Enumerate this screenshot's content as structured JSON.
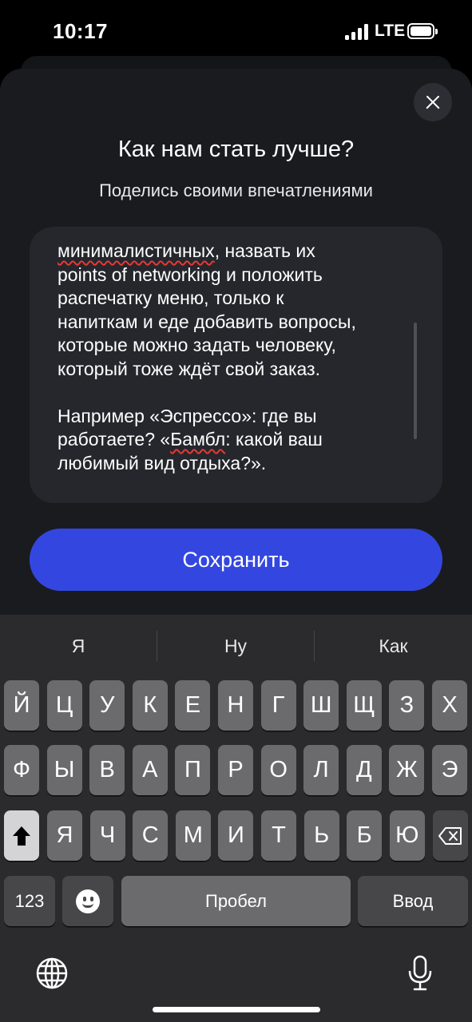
{
  "status": {
    "time": "10:17",
    "network": "LTE"
  },
  "sheet": {
    "title": "Как нам стать лучше?",
    "subtitle": "Поделись своими впечатлениями",
    "feedback": {
      "line1_misspelled": "минималистичных",
      "line1_rest": ", назвать их",
      "line2": "points of networking и положить",
      "line3": "распечатку меню, только к",
      "line4": "напиткам и еде добавить вопросы,",
      "line5": "которые можно задать человеку,",
      "line6": "который тоже ждёт свой заказ.",
      "line7": "Например «Эспрессо»: где вы",
      "line8_start": "работаете? «",
      "line8_misspelled": "Бамбл",
      "line8_rest": ": какой ваш",
      "line9": "любимый вид отдыха?»."
    },
    "save_label": "Сохранить"
  },
  "keyboard": {
    "suggestions": [
      "Я",
      "Ну",
      "Как"
    ],
    "row1": [
      "Й",
      "Ц",
      "У",
      "К",
      "Е",
      "Н",
      "Г",
      "Ш",
      "Щ",
      "З",
      "Х"
    ],
    "row2": [
      "Ф",
      "Ы",
      "В",
      "А",
      "П",
      "Р",
      "О",
      "Л",
      "Д",
      "Ж",
      "Э"
    ],
    "row3": [
      "Я",
      "Ч",
      "С",
      "М",
      "И",
      "Т",
      "Ь",
      "Б",
      "Ю"
    ],
    "numbers_label": "123",
    "space_label": "Пробел",
    "return_label": "Ввод"
  }
}
